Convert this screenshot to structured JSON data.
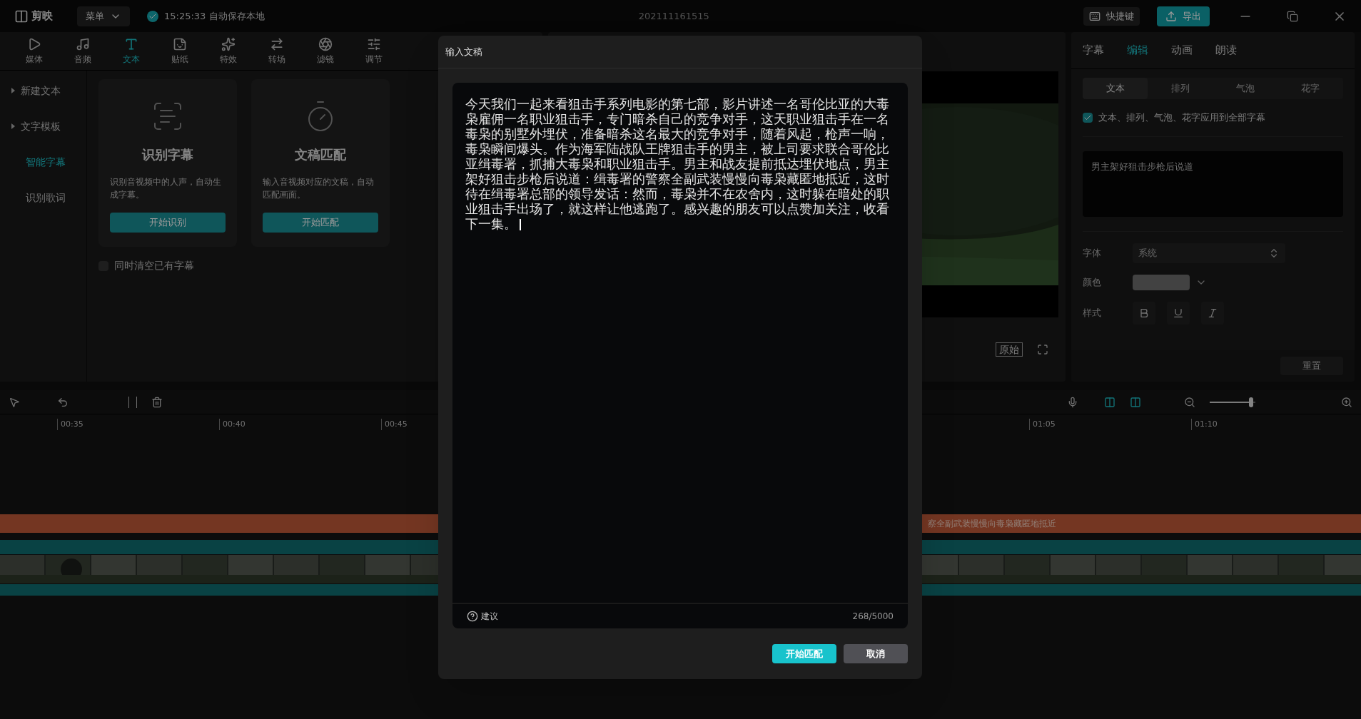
{
  "topbar": {
    "logo": "剪映",
    "menu": "菜单",
    "save_status": "15:25:33 自动保存本地",
    "project_title": "202111161515",
    "shortcut": "快捷键",
    "export": "导出"
  },
  "media_tabs": [
    {
      "label": "媒体",
      "selected": false
    },
    {
      "label": "音频",
      "selected": false
    },
    {
      "label": "文本",
      "selected": true
    },
    {
      "label": "贴纸",
      "selected": false
    },
    {
      "label": "特效",
      "selected": false
    },
    {
      "label": "转场",
      "selected": false
    },
    {
      "label": "滤镜",
      "selected": false
    },
    {
      "label": "调节",
      "selected": false
    }
  ],
  "side_nav": [
    {
      "label": "新建文本",
      "kind": "group",
      "selected": false
    },
    {
      "label": "文字模板",
      "kind": "group",
      "selected": false
    },
    {
      "label": "智能字幕",
      "kind": "item",
      "selected": true
    },
    {
      "label": "识别歌词",
      "kind": "item",
      "selected": false
    }
  ],
  "cards": [
    {
      "title": "识别字幕",
      "description": "识别音视频中的人声，自动生成字幕。",
      "button": "开始识别"
    },
    {
      "title": "文稿匹配",
      "description": "输入音视频对应的文稿，自动匹配画面。",
      "button": "开始匹配"
    }
  ],
  "clear_checkbox": {
    "label": "同时清空已有字幕",
    "checked": false
  },
  "preview": {
    "original_button": "原始"
  },
  "right_panel": {
    "tabs": [
      {
        "label": "字幕",
        "selected": false
      },
      {
        "label": "编辑",
        "selected": true
      },
      {
        "label": "动画",
        "selected": false
      },
      {
        "label": "朗读",
        "selected": false
      }
    ],
    "subtabs": [
      {
        "label": "文本",
        "selected": true
      },
      {
        "label": "排列",
        "selected": false
      },
      {
        "label": "气泡",
        "selected": false
      },
      {
        "label": "花字",
        "selected": false
      }
    ],
    "apply_all": {
      "label": "文本、排列、气泡、花字应用到全部字幕",
      "checked": true
    },
    "subtitle_text": "男主架好狙击步枪后说道",
    "font_label": "字体",
    "font_value": "系统",
    "color_label": "颜色",
    "style_label": "样式",
    "reset": "重置"
  },
  "timeline": {
    "ticks_left": [
      "00:35",
      "00:40",
      "00:45"
    ],
    "ticks_right": [
      "01:05",
      "01:10"
    ],
    "subtitle_clip": "察全副武装慢慢向毒枭藏匿地抵近",
    "zoom": {
      "level": 0.9
    }
  },
  "dialog": {
    "title": "输入文稿",
    "text": "今天我们一起来看狙击手系列电影的第七部，影片讲述一名哥伦比亚的大毒枭雇佣一名职业狙击手，专门暗杀自己的竞争对手，这天职业狙击手在一名毒枭的别墅外埋伏，准备暗杀这名最大的竞争对手，随着风起，枪声一响，毒枭瞬间爆头。作为海军陆战队王牌狙击手的男主，被上司要求联合哥伦比亚缉毒署，抓捕大毒枭和职业狙击手。男主和战友提前抵达埋伏地点，男主架好狙击步枪后说道：缉毒署的警察全副武装慢慢向毒枭藏匿地抵近，这时待在缉毒署总部的领导发话：然而，毒枭并不在农舍内，这时躲在暗处的职业狙击手出场了，就这样让他逃跑了。感兴趣的朋友可以点赞加关注，收看下一集。",
    "hint": "建议",
    "count": "268/5000",
    "confirm": "开始匹配",
    "cancel": "取消"
  }
}
